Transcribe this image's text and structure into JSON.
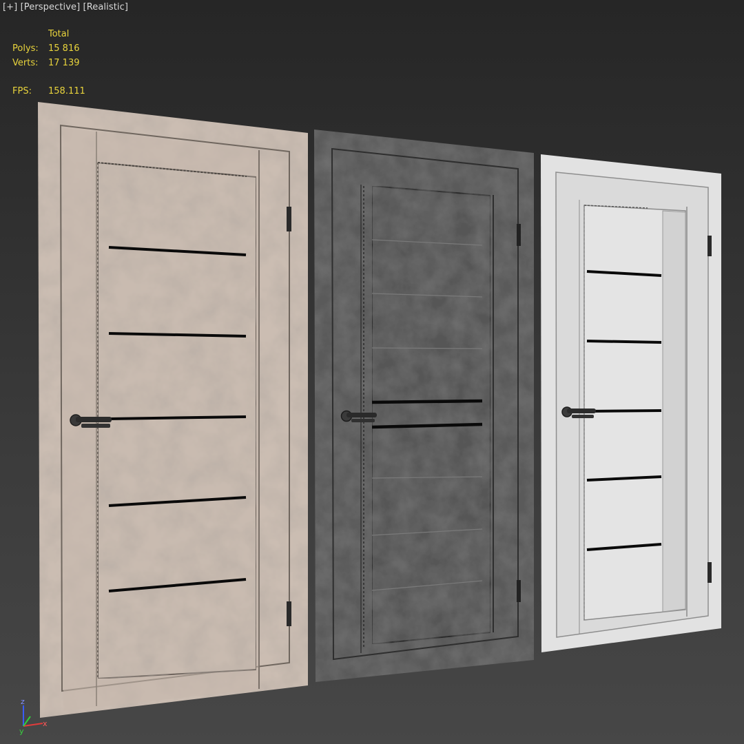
{
  "viewport": {
    "label_parts": [
      "[+]",
      "[Perspective]",
      "[Realistic]"
    ]
  },
  "stats": {
    "header": "Total",
    "polys_label": "Polys:",
    "polys_value": "15 816",
    "verts_label": "Verts:",
    "verts_value": "17 139",
    "fps_label": "FPS:",
    "fps_value": "158.111"
  },
  "axis_gizmo": {
    "z": "z",
    "y": "y",
    "x": "x"
  },
  "colors": {
    "stats_text": "#e9d43c",
    "viewport_label": "#d8d8d8",
    "door_beige": "#cbbdb2",
    "door_dark": "#5a5a5a",
    "door_white": "#e2e2e2",
    "glass_strip": "#0a0a0a"
  },
  "objects": [
    {
      "name": "door-beige-concrete",
      "icon": "door"
    },
    {
      "name": "door-dark-concrete",
      "icon": "door"
    },
    {
      "name": "door-white",
      "icon": "door"
    }
  ]
}
